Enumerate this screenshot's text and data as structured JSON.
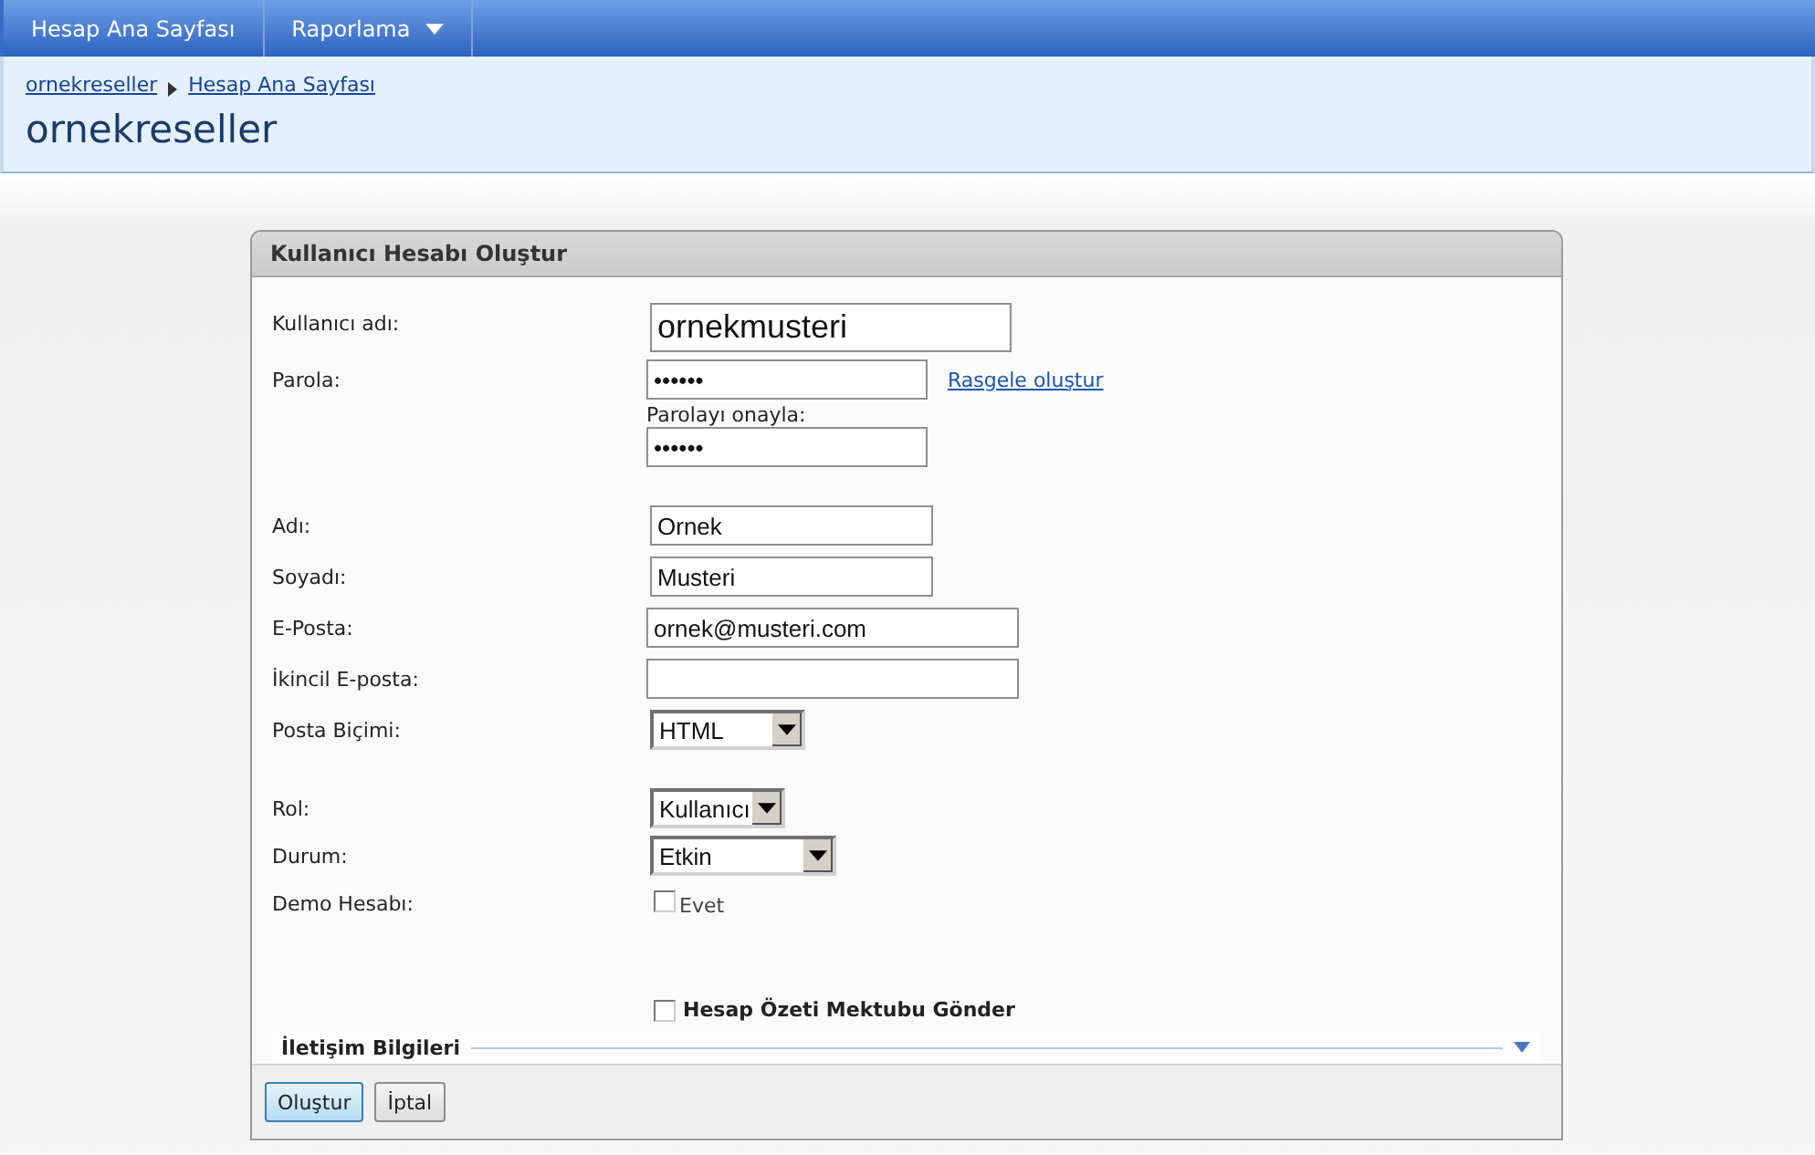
{
  "nav": {
    "items": [
      {
        "label": "Hesap Ana Sayfası",
        "has_menu": false
      },
      {
        "label": "Raporlama",
        "has_menu": true
      }
    ]
  },
  "breadcrumb": [
    "ornekreseller",
    "Hesap Ana Sayfası"
  ],
  "page_title": "ornekreseller",
  "form": {
    "title": "Kullanıcı Hesabı Oluştur",
    "groups": [
      [
        {
          "kind": "text",
          "label": "Kullanıcı adı:",
          "value": "ornekmusteri"
        },
        {
          "kind": "password",
          "label": "Parola:",
          "value": "••••••",
          "link": "Rasgele oluştur",
          "confirm_label": "Parolayı onayla:",
          "confirm_value": "••••••"
        }
      ],
      [
        {
          "kind": "text",
          "label": "Adı:",
          "value": "Ornek"
        },
        {
          "kind": "text",
          "label": "Soyadı:",
          "value": "Musteri"
        },
        {
          "kind": "text",
          "label": "E-Posta:",
          "value": "ornek@musteri.com"
        },
        {
          "kind": "text",
          "label": "İkincil E-posta:"
        },
        {
          "kind": "select",
          "label": "Posta Biçimi:",
          "value": "HTML"
        }
      ],
      [
        {
          "kind": "select",
          "label": "Rol:",
          "value": "Kullanıcı"
        },
        {
          "kind": "select",
          "label": "Durum:",
          "value": "Etkin"
        },
        {
          "kind": "checkbox",
          "label": "Demo Hesabı:",
          "option": "Evet",
          "checked": false
        }
      ]
    ],
    "send_summary": {
      "label": "Hesap Özeti Mektubu Gönder",
      "checked": false
    },
    "section": {
      "title": "İletişim Bilgileri",
      "expanded": false
    },
    "buttons": [
      {
        "label": "Oluştur",
        "primary": true
      },
      {
        "label": "İptal",
        "primary": false
      }
    ]
  }
}
